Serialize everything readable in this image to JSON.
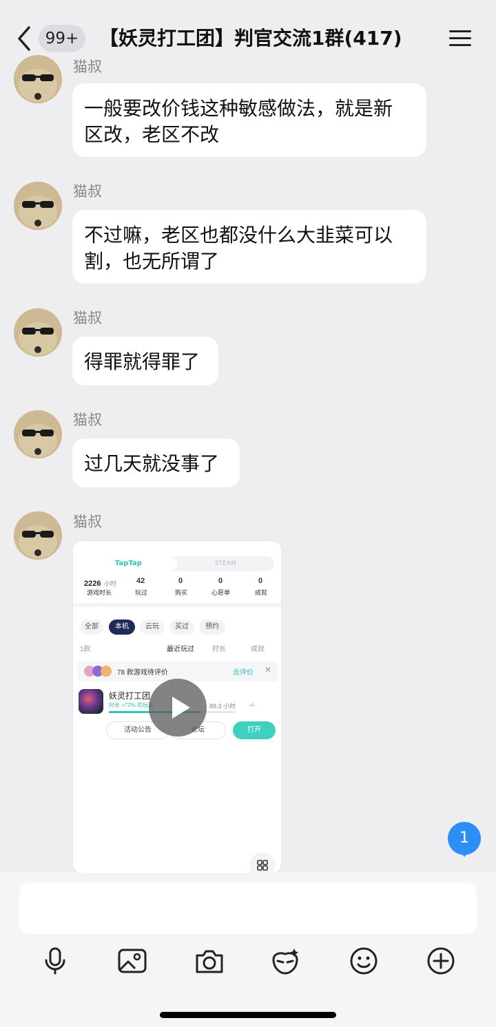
{
  "header": {
    "unread_badge": "99+",
    "title": "【妖灵打工团】判官交流1群(417)"
  },
  "messages": [
    {
      "sender": "猫叔",
      "text_lines": [
        "一般要改价钱这种敏感做法，就是新",
        "区改，老区不改"
      ]
    },
    {
      "sender": "猫叔",
      "text_lines": [
        "不过嘛，老区也都没什么大韭菜可以",
        "割，也无所谓了"
      ]
    },
    {
      "sender": "猫叔",
      "text_lines": [
        "得罪就得罪了"
      ]
    },
    {
      "sender": "猫叔",
      "text_lines": [
        "过几天就没事了"
      ]
    },
    {
      "sender": "猫叔"
    }
  ],
  "shared_video": {
    "tabs": [
      "TapTap",
      "STEAM"
    ],
    "stats": [
      {
        "value": "2226",
        "unit": "小时",
        "label": "游戏时长"
      },
      {
        "value": "42",
        "label": "玩过"
      },
      {
        "value": "0",
        "label": "购买"
      },
      {
        "value": "0",
        "label": "心愿单"
      },
      {
        "value": "0",
        "label": "成就"
      }
    ],
    "filters": [
      "全部",
      "本机",
      "云玩",
      "买过",
      "预约"
    ],
    "active_filter": "本机",
    "list_count": "1款",
    "sort_options": [
      "最近玩过",
      "时长",
      "成就"
    ],
    "pending_text": "78 款游戏待评价",
    "pending_action": "去评价",
    "game": {
      "name": "妖灵打工团",
      "playtime_note": "时长 >72% 的玩家",
      "hours": "88.3 小时",
      "rating": "-/-",
      "progress_fraction": 0.72
    },
    "buttons": {
      "notice": "活动公告",
      "forum": "论坛",
      "open": "打开"
    }
  },
  "unread_new": "1",
  "colors": {
    "background": "#eeeef1",
    "bubble": "#ffffff",
    "badge_blue": "#2d8ef7",
    "taptap_teal": "#2fc1b6"
  },
  "toolbar_icons": [
    "microphone-icon",
    "image-icon",
    "camera-icon",
    "mask-icon",
    "emoji-icon",
    "plus-icon"
  ]
}
